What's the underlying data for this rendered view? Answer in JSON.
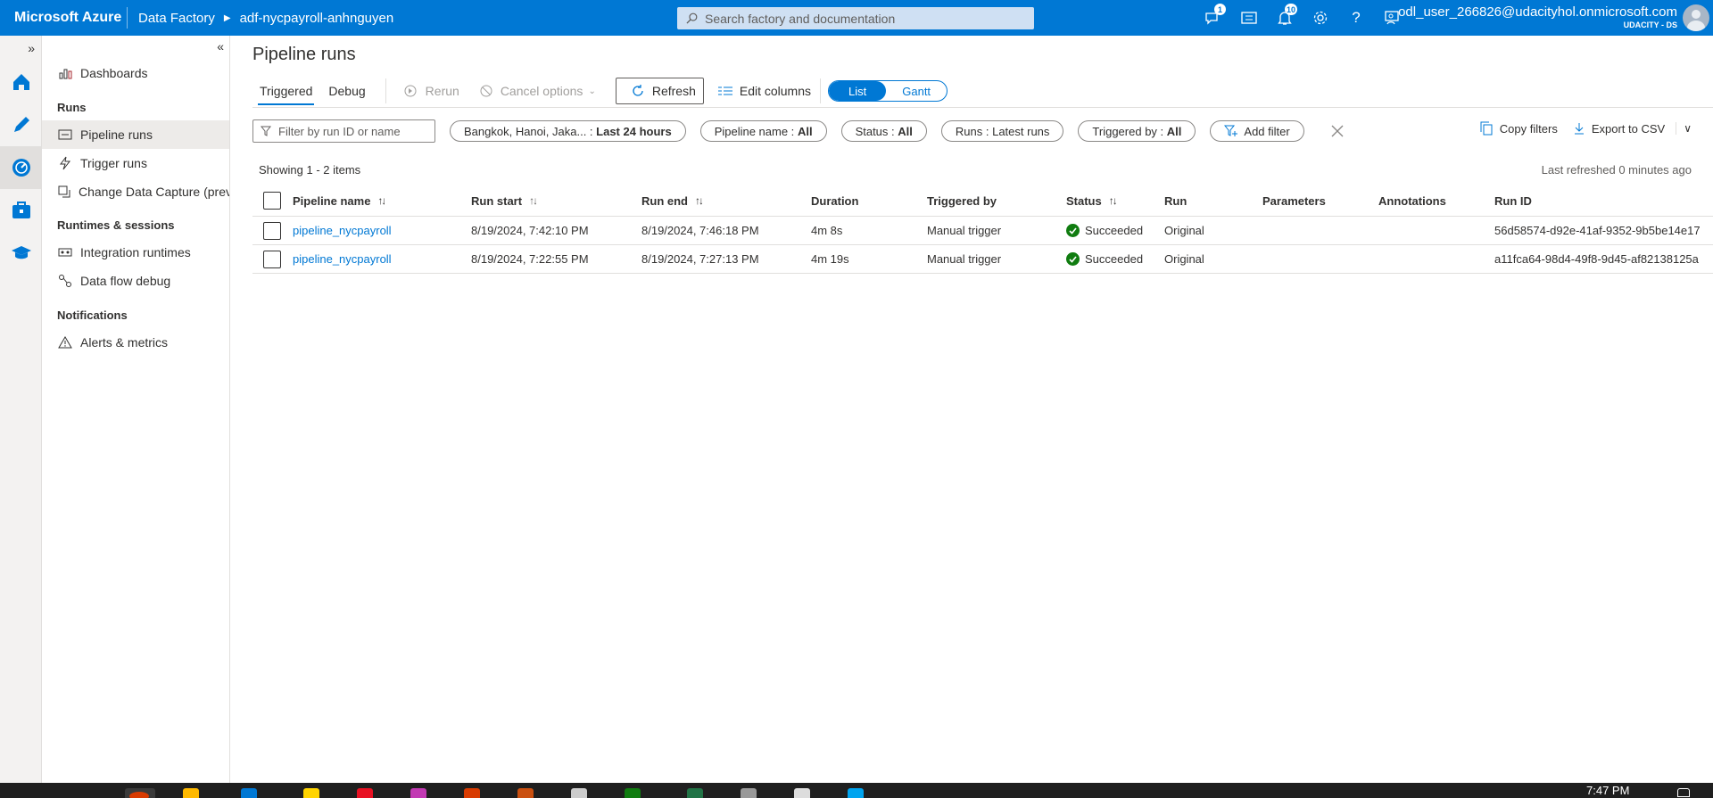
{
  "topbar": {
    "brand": "Microsoft Azure",
    "service": "Data Factory",
    "factory": "adf-nycpayroll-anhnguyen",
    "search_placeholder": "Search factory and documentation",
    "feedback_badge": "1",
    "notifications_badge": "10",
    "account_email": "odl_user_266826@udacityhol.onmicrosoft.com",
    "account_tenant": "UDACITY - DS"
  },
  "rail": {
    "icons": [
      "home-icon",
      "author-icon",
      "monitor-icon",
      "manage-icon",
      "learning-center-icon"
    ]
  },
  "nav": {
    "dashboards": "Dashboards",
    "runs_header": "Runs",
    "pipeline_runs": "Pipeline runs",
    "trigger_runs": "Trigger runs",
    "change_data_capture": "Change Data Capture (previ...",
    "runtimes_header": "Runtimes & sessions",
    "integration_runtimes": "Integration runtimes",
    "data_flow_debug": "Data flow debug",
    "notifications_header": "Notifications",
    "alerts_metrics": "Alerts & metrics"
  },
  "page": {
    "title": "Pipeline runs",
    "tabs": {
      "triggered": "Triggered",
      "debug": "Debug"
    },
    "toolbar": {
      "rerun": "Rerun",
      "cancel_options": "Cancel options",
      "refresh": "Refresh",
      "edit_columns": "Edit columns",
      "list": "List",
      "gantt": "Gantt"
    },
    "filters": {
      "search_placeholder": "Filter by run ID or name",
      "timezone": "Bangkok, Hanoi, Jaka...",
      "time_range": "Last 24 hours",
      "pipeline_name_label": "Pipeline name : ",
      "pipeline_name_value": "All",
      "status_label": "Status : ",
      "status_value": "All",
      "runs_label": "Runs : ",
      "runs_value": "Latest runs",
      "triggered_by_label": "Triggered by : ",
      "triggered_by_value": "All",
      "add_filter": "Add filter",
      "copy_filters": "Copy filters",
      "export_csv": "Export to CSV"
    },
    "showing": "Showing 1 - 2 items",
    "last_refreshed": "Last refreshed 0 minutes ago"
  },
  "table": {
    "headers": {
      "pipeline_name": "Pipeline name",
      "run_start": "Run start",
      "run_end": "Run end",
      "duration": "Duration",
      "triggered_by": "Triggered by",
      "status": "Status",
      "run": "Run",
      "parameters": "Parameters",
      "annotations": "Annotations",
      "run_id": "Run ID"
    },
    "rows": [
      {
        "pipeline_name": "pipeline_nycpayroll",
        "run_start": "8/19/2024, 7:42:10 PM",
        "run_end": "8/19/2024, 7:46:18 PM",
        "duration": "4m 8s",
        "triggered_by": "Manual trigger",
        "status": "Succeeded",
        "run": "Original",
        "run_id": "56d58574-d92e-41af-9352-9b5be14e17"
      },
      {
        "pipeline_name": "pipeline_nycpayroll",
        "run_start": "8/19/2024, 7:22:55 PM",
        "run_end": "8/19/2024, 7:27:13 PM",
        "duration": "4m 19s",
        "triggered_by": "Manual trigger",
        "status": "Succeeded",
        "run": "Original",
        "run_id": "a11fca64-98d4-49f8-9d45-af82138125a"
      }
    ]
  },
  "taskbar": {
    "clock": "7:47 PM"
  },
  "colors": {
    "accent": "#0078d4",
    "success": "#107c10"
  }
}
